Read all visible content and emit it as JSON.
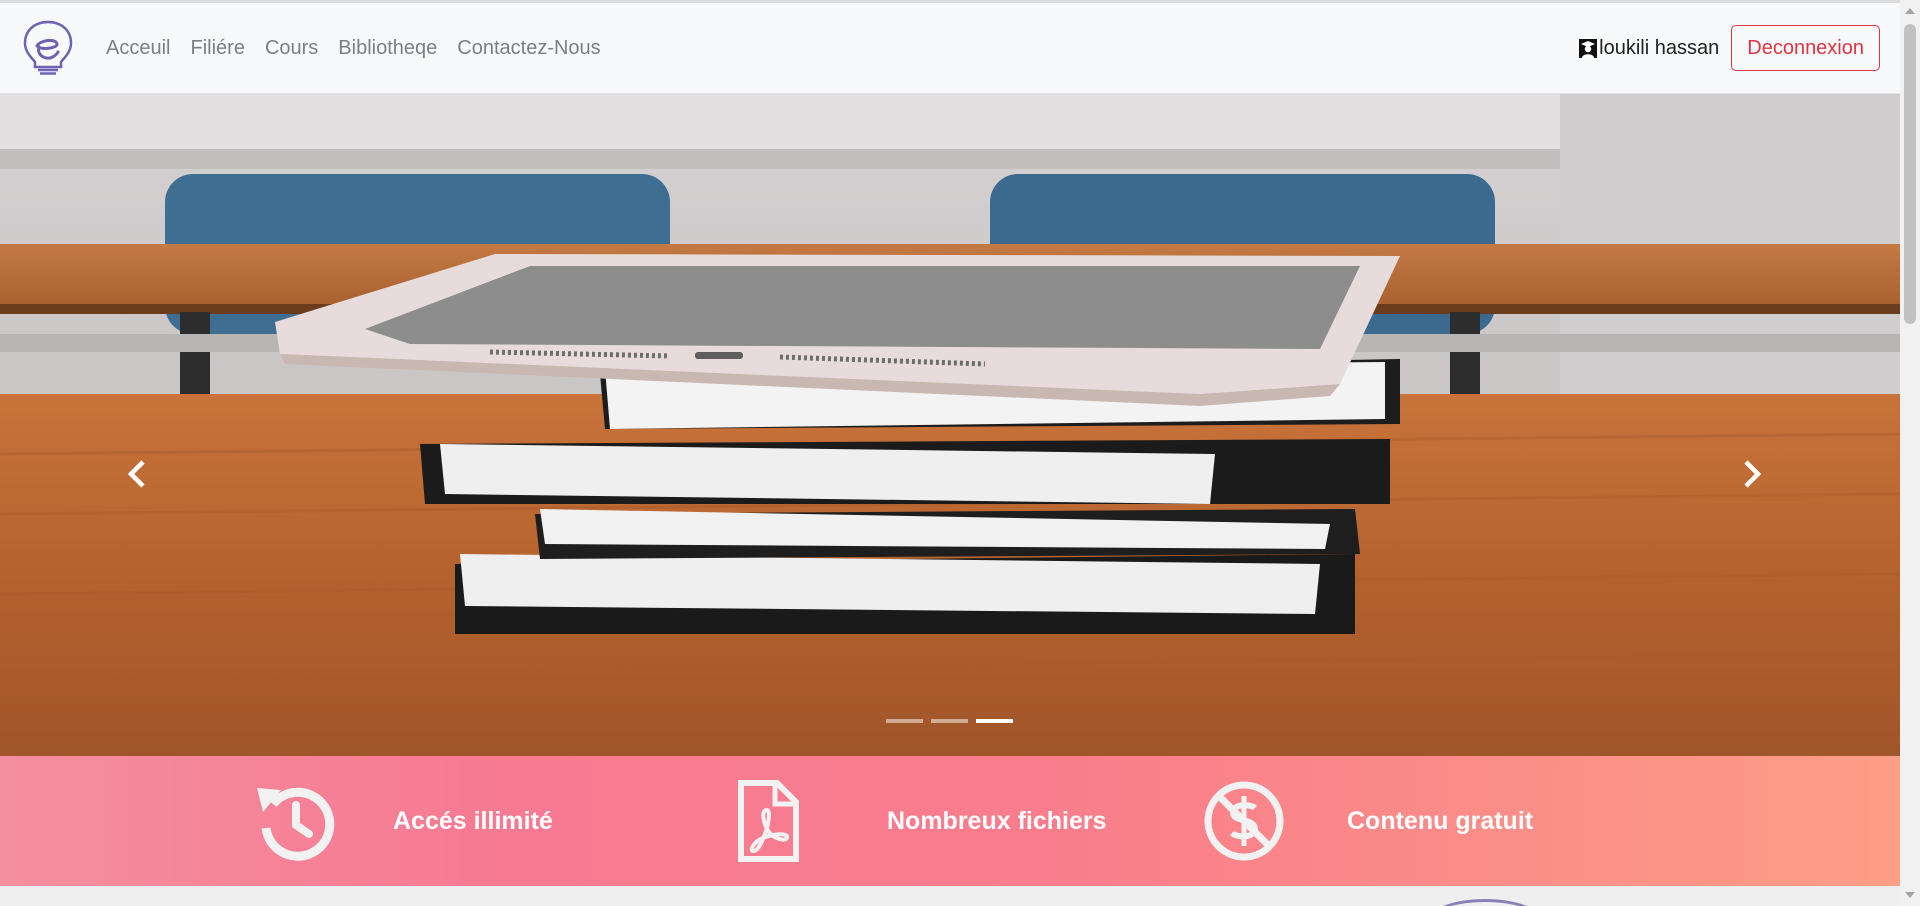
{
  "navbar": {
    "logo_icon": "lightbulb-e-logo-icon",
    "links": [
      {
        "label": "Acceuil"
      },
      {
        "label": "Filiére"
      },
      {
        "label": "Cours"
      },
      {
        "label": "Bibliotheqe"
      },
      {
        "label": "Contactez-Nous"
      }
    ],
    "user": {
      "icon": "graduate-icon",
      "name": "loukili hassan"
    },
    "logout_label": "Deconnexion",
    "logout_color": "#dc3545"
  },
  "carousel": {
    "image_description_icon": "tablet-on-books-photo",
    "slide_count": 3,
    "active_slide": 3,
    "prev_icon": "chevron-left-icon",
    "next_icon": "chevron-right-icon"
  },
  "features": [
    {
      "icon": "history-icon",
      "label": "Accés illimité"
    },
    {
      "icon": "pdf-file-icon",
      "label": "Nombreux fichiers"
    },
    {
      "icon": "no-dollar-icon",
      "label": "Contenu gratuit"
    }
  ],
  "colors": {
    "features_gradient_start": "#f48fa0",
    "features_gradient_end": "#fd9e86",
    "logo_color": "#6f62b3"
  }
}
